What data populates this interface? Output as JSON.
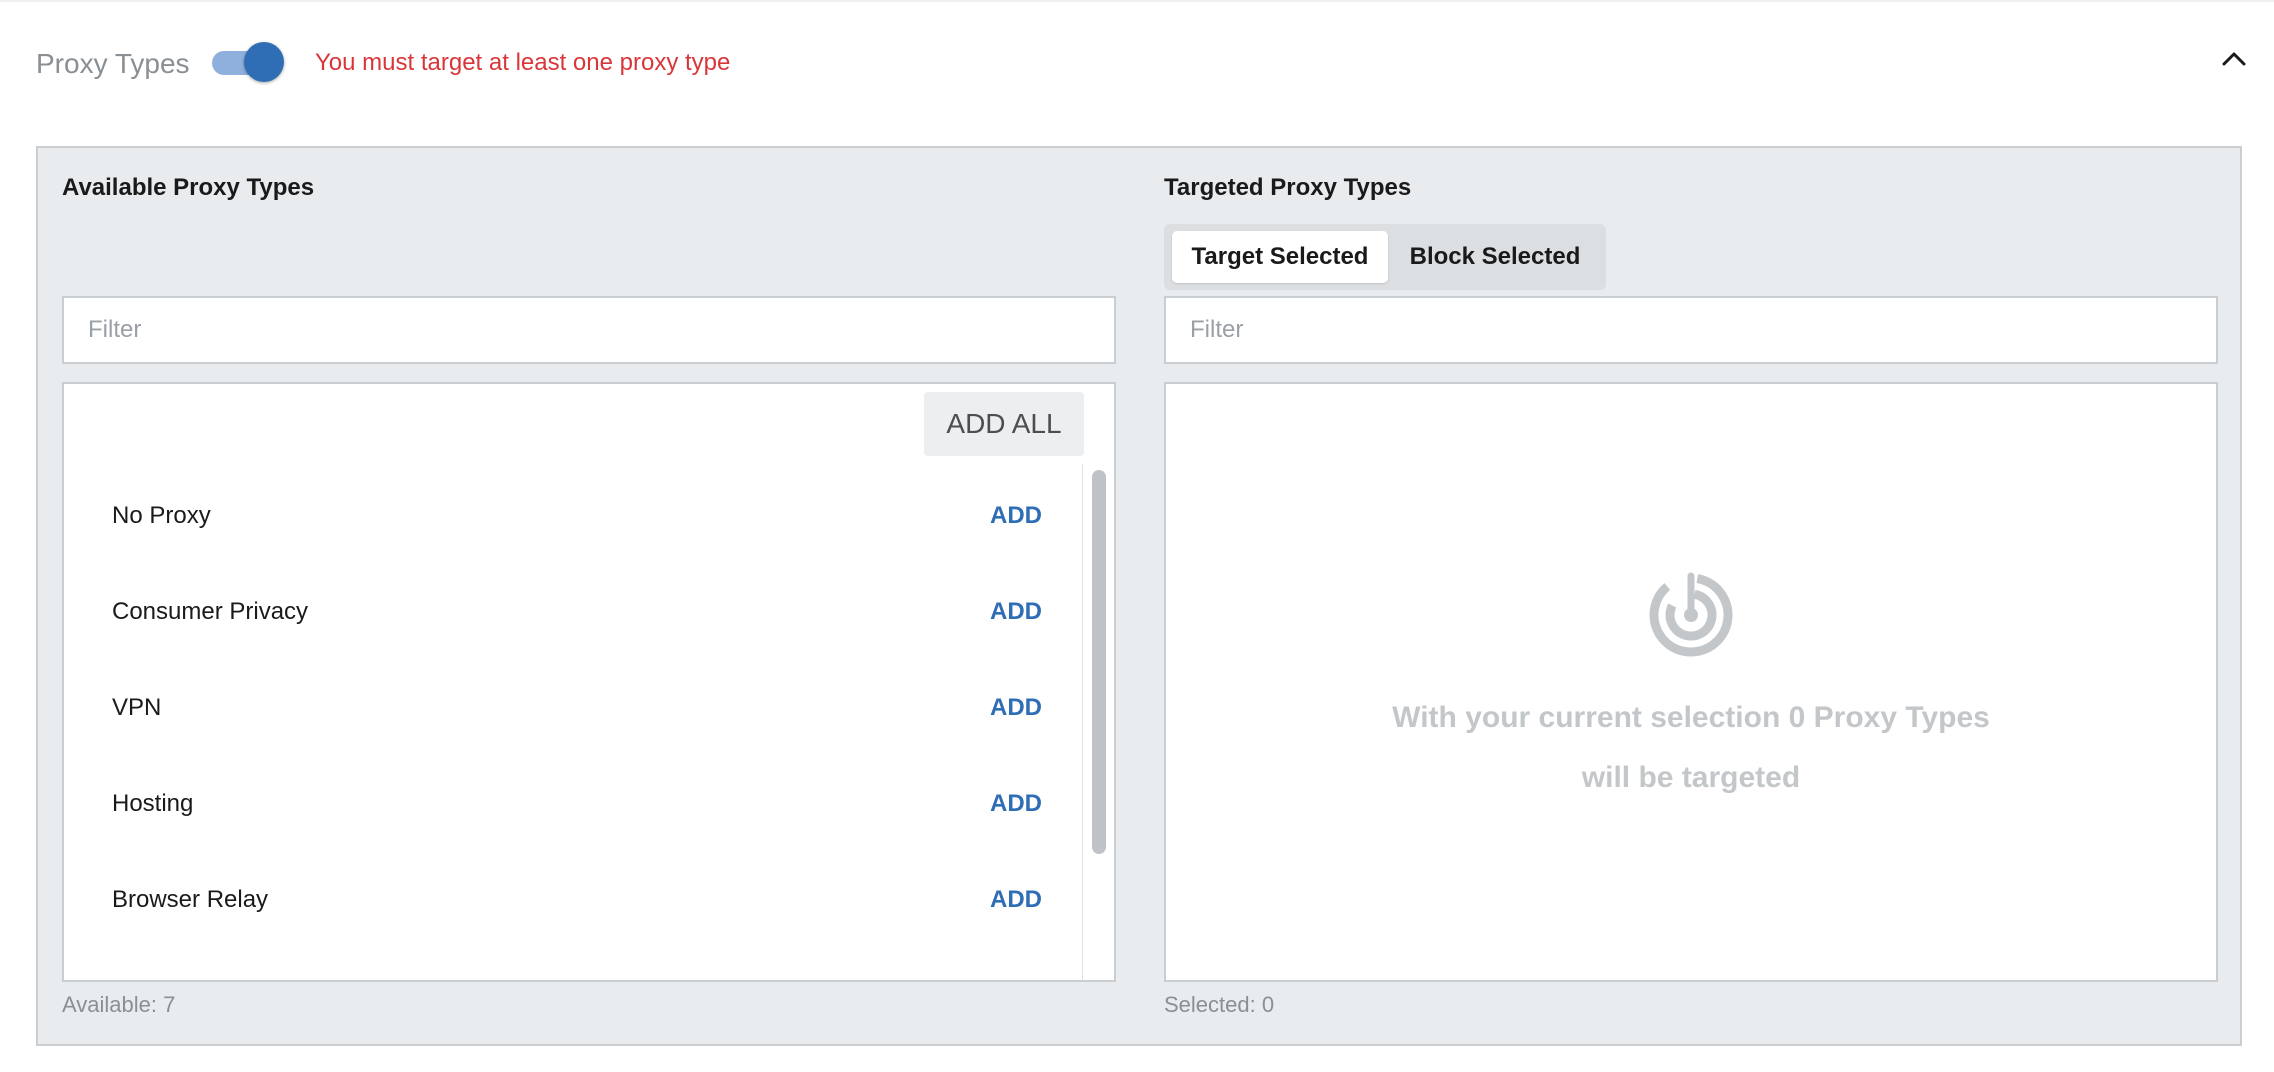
{
  "section": {
    "title": "Proxy Types",
    "toggle_on": true,
    "error": "You must target at least one proxy type",
    "collapse_icon": "chevron-up-icon"
  },
  "available": {
    "title": "Available Proxy Types",
    "filter_placeholder": "Filter",
    "add_all_label": "ADD ALL",
    "items": [
      {
        "label": "No Proxy",
        "action": "ADD"
      },
      {
        "label": "Consumer Privacy",
        "action": "ADD"
      },
      {
        "label": "VPN",
        "action": "ADD"
      },
      {
        "label": "Hosting",
        "action": "ADD"
      },
      {
        "label": "Browser Relay",
        "action": "ADD"
      }
    ],
    "count_text": "Available: 7"
  },
  "targeted": {
    "title": "Targeted Proxy Types",
    "mode_options": [
      "Target Selected",
      "Block Selected"
    ],
    "active_mode": "Target Selected",
    "filter_placeholder": "Filter",
    "empty_icon": "target-icon",
    "empty_message": "With your current selection 0 Proxy Types will be targeted",
    "count_text": "Selected: 0"
  },
  "colors": {
    "accent": "#2f6db5",
    "error": "#d9363a",
    "panel_bg": "#e9ecee"
  }
}
